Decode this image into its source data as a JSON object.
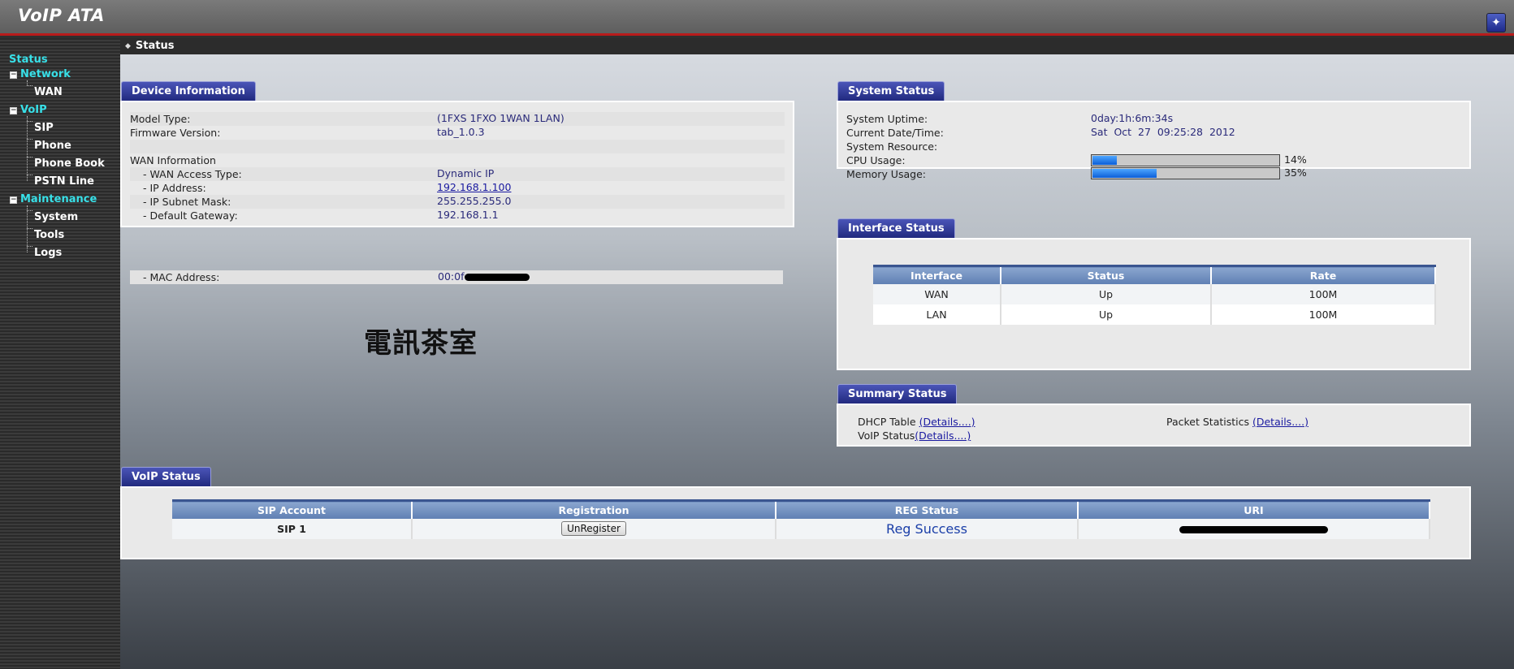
{
  "app": {
    "title": "VoIP ATA",
    "wizard_icon": "wand-icon"
  },
  "breadcrumb": {
    "current": "Status"
  },
  "sidebar": {
    "top": "Status",
    "sections": [
      {
        "label": "Network",
        "items": [
          "WAN"
        ]
      },
      {
        "label": "VoIP",
        "items": [
          "SIP",
          "Phone",
          "Phone Book",
          "PSTN Line"
        ]
      },
      {
        "label": "Maintenance",
        "items": [
          "System",
          "Tools",
          "Logs"
        ]
      }
    ]
  },
  "device_info": {
    "title": "Device Information",
    "model_label": "Model Type:",
    "model_value": "(1FXS 1FXO 1WAN 1LAN)",
    "firmware_label": "Firmware Version:",
    "firmware_value": "tab_1.0.3",
    "wan_info_label": "WAN Information",
    "access_label": "- WAN Access Type:",
    "access_value": "Dynamic IP",
    "ip_label": "- IP Address:",
    "ip_value": "192.168.1.100",
    "mask_label": "- IP Subnet Mask:",
    "mask_value": "255.255.255.0",
    "gw_label": "- Default Gateway:",
    "gw_value": "192.168.1.1",
    "mac_label": "- MAC Address:",
    "mac_value": "00:0f"
  },
  "system_status": {
    "title": "System Status",
    "uptime_label": "System Uptime:",
    "uptime_value": "0day:1h:6m:34s",
    "date_label": "Current Date/Time:",
    "date_value": "Sat  Oct  27  09:25:28  2012",
    "resource_label": "System Resource:",
    "cpu_label": "CPU Usage:",
    "cpu_value": "14%",
    "cpu_percent": 14,
    "mem_label": "Memory Usage:",
    "mem_value": "35%",
    "mem_percent": 35
  },
  "interface_status": {
    "title": "Interface Status",
    "headers": [
      "Interface",
      "Status",
      "Rate"
    ],
    "rows": [
      [
        "WAN",
        "Up",
        "100M"
      ],
      [
        "LAN",
        "Up",
        "100M"
      ]
    ]
  },
  "summary_status": {
    "title": "Summary Status",
    "dhcp_label": "DHCP Table ",
    "dhcp_link": "(Details....)",
    "voip_label": "VoIP Status",
    "voip_link": "(Details....)",
    "packet_label": "Packet Statistics ",
    "packet_link": "(Details....)"
  },
  "watermark": "電訊茶室",
  "voip_status": {
    "title": "VoIP Status",
    "headers": [
      "SIP Account",
      "Registration",
      "REG Status",
      "URI"
    ],
    "account": "SIP 1",
    "button": "UnRegister",
    "reg_status": "Reg Success",
    "reg_status_color": "#1a3ea8"
  },
  "colors": {
    "accent_red": "#b81b1b",
    "nav_cyan": "#38e0e8",
    "tab_blue": "#1f287c"
  }
}
